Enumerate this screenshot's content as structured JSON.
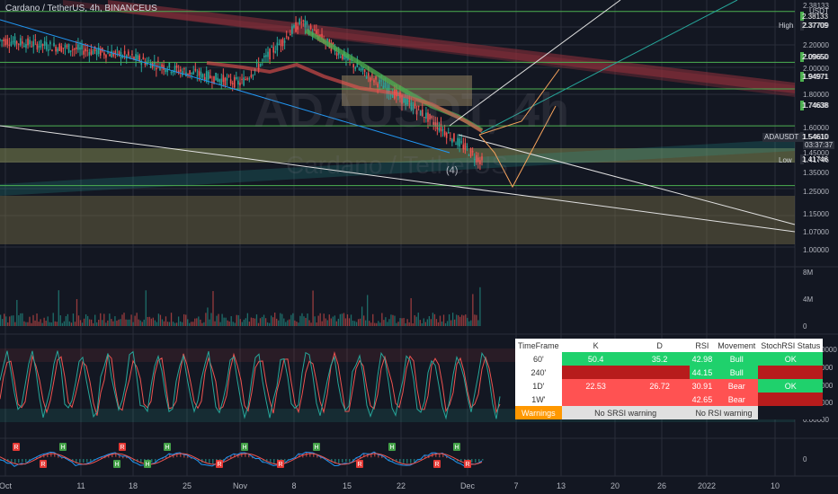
{
  "header": {
    "title": "Cardano / TetherUS, 4h, BINANCEUS",
    "currency": "USDT",
    "watermark_symbol": "ADAUSDT, 4h",
    "watermark_name": "Cardano / TetherUS"
  },
  "colors": {
    "bg": "#131722",
    "grid": "#2a2e39",
    "green": "#26a69a",
    "red": "#ef5350",
    "tag_green": "#4caf50",
    "orange": "#f7a35c",
    "resistance_band": "rgba(150,50,60,0.55)",
    "demand_zone": "rgba(120,110,70,0.45)",
    "supply_zone": "rgba(160,140,100,0.5)"
  },
  "price_axis": {
    "ticks": [
      "2.38133",
      "2.37709",
      "2.20000",
      "2.09650",
      "2.00000",
      "1.94971",
      "1.80000",
      "1.74638",
      "1.60000",
      "1.54610",
      "1.45000",
      "1.41746",
      "1.35000",
      "1.25000",
      "1.15000",
      "1.07000",
      "1.00000"
    ],
    "max": 2.44,
    "min": 0.97
  },
  "price_tags": [
    {
      "value": "2.38133",
      "kind": "green"
    },
    {
      "value": "2.09650",
      "kind": "green"
    },
    {
      "value": "1.94971",
      "kind": "green"
    },
    {
      "value": "1.74638",
      "kind": "green"
    },
    {
      "value": "1.54610",
      "kind": "dark"
    },
    {
      "value": "1.41746",
      "kind": "dark"
    },
    {
      "value": "2.37709",
      "kind": "dark"
    }
  ],
  "countdown": "03:37:37",
  "symbol_tag": "ADAUSDT",
  "high_label": "High",
  "low_label": "Low",
  "wave_label": "(4)",
  "volume_axis": [
    "8M",
    "4M",
    "0"
  ],
  "osc_axis": [
    "100.00000",
    "75.00000",
    "50.00000",
    "25.00000",
    "0.00000"
  ],
  "bottom_axis": [
    "0"
  ],
  "time_axis": [
    "Oct",
    "11",
    "18",
    "25",
    "Nov",
    "8",
    "15",
    "22",
    "Dec",
    "7",
    "13",
    "20",
    "26",
    "2022",
    "10"
  ],
  "markers": [
    "R",
    "R",
    "H",
    "H",
    "R",
    "H",
    "H",
    "R",
    "H",
    "R",
    "H",
    "R",
    "H",
    "R",
    "H",
    "R"
  ],
  "table": {
    "headers": [
      "TimeFrame",
      "K",
      "D",
      "RSI",
      "Movement",
      "StochRSI Status"
    ],
    "rows": [
      {
        "tf": "60'",
        "k": "50.4",
        "d": "35.2",
        "rsi": "42.98",
        "mov": "Bull",
        "status": "OK"
      },
      {
        "tf": "240'",
        "k": "",
        "d": "",
        "rsi": "44.15",
        "mov": "Bull",
        "status": ""
      },
      {
        "tf": "1D'",
        "k": "22.53",
        "d": "26.72",
        "rsi": "30.91",
        "mov": "Bear",
        "status": "OK"
      },
      {
        "tf": "1W'",
        "k": "",
        "d": "",
        "rsi": "42.65",
        "mov": "Bear",
        "status": ""
      }
    ],
    "warnings_label": "Warnings",
    "srsi_warning": "No SRSI warning",
    "rsi_warning": "No RSI warning"
  },
  "chart_data": {
    "type": "line",
    "title": "Cardano / TetherUS, 4h, BINANCEUS",
    "ylim": [
      0.97,
      2.44
    ],
    "x": [
      "Oct",
      "11",
      "18",
      "25",
      "Nov",
      "8",
      "15",
      "22",
      "Dec"
    ],
    "series": [
      {
        "values": [
          2.22,
          2.18,
          2.14,
          2.05,
          1.98,
          2.32,
          2.05,
          1.82,
          1.55
        ]
      }
    ],
    "horizontal_levels": [
      2.37709,
      2.0965,
      1.94971,
      1.74638,
      1.41746
    ]
  }
}
